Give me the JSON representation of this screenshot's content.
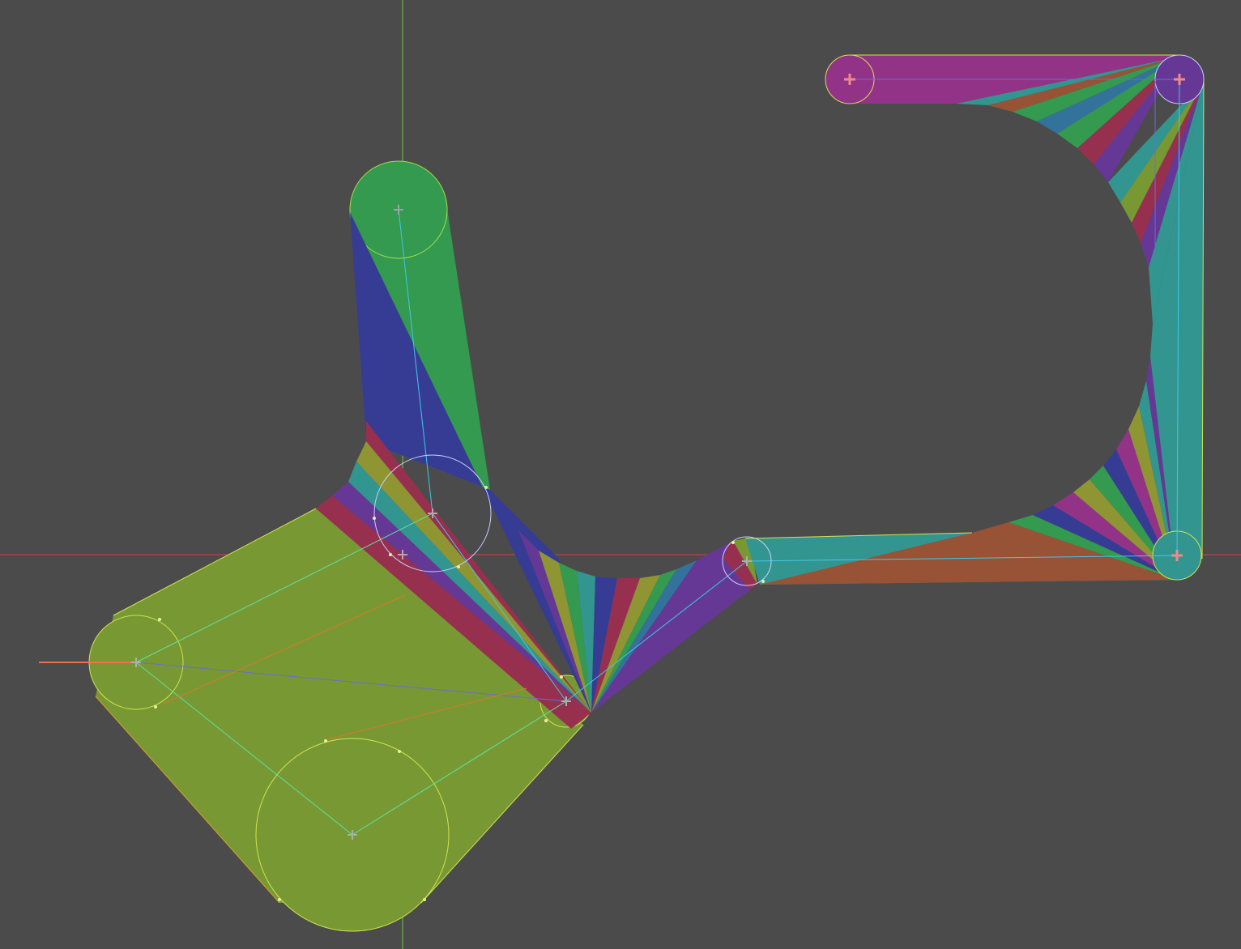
{
  "editor": {
    "canvas_background": "#4b4b4b",
    "axes": {
      "x_axis_color": "#d24040",
      "x_axis_negative_color": "#c040c0",
      "y_axis_color": "#74c04a"
    }
  },
  "colors": {
    "yellow_green": "#789834",
    "green": "#339a50",
    "blue": "#363c94",
    "purple": "#653896",
    "magenta": "#933388",
    "teal": "#339590",
    "crimson": "#97304f",
    "orange_brown": "#985236",
    "olive": "#8f9533",
    "steel": "#33729a",
    "outline": "#cfe34d",
    "skeleton": "#5fe0a0",
    "circle_outline_light": "#c8d0ff"
  },
  "icons": {
    "point_handle": "crosshair-icon",
    "selected_point_handle": "selected-crosshair-icon"
  }
}
